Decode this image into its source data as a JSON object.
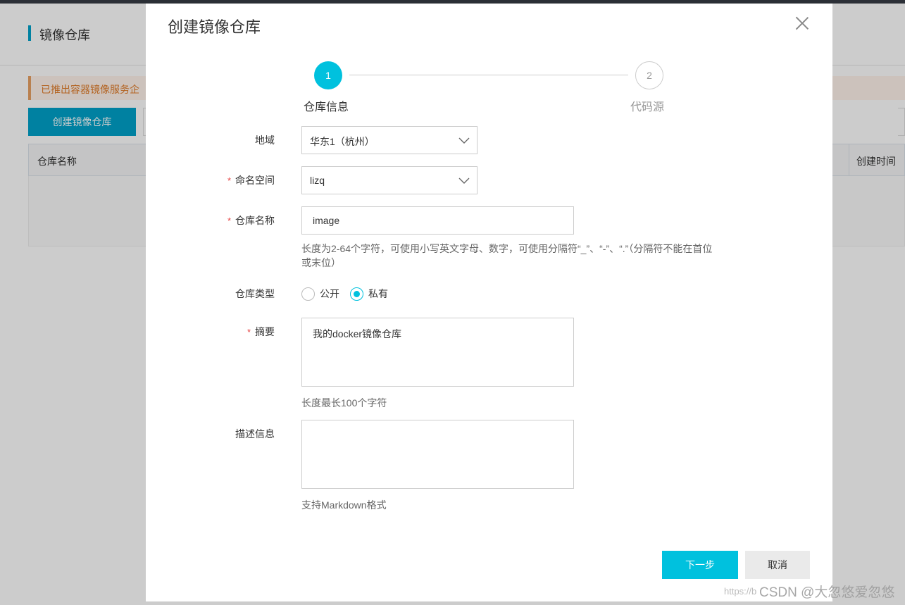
{
  "background": {
    "page_title": "镜像仓库",
    "notice": "已推出容器镜像服务企",
    "create_button": "创建镜像仓库",
    "table": {
      "col_name": "仓库名称",
      "col_created": "创建时间"
    }
  },
  "dialog": {
    "title": "创建镜像仓库",
    "steps": [
      {
        "number": "1",
        "label": "仓库信息"
      },
      {
        "number": "2",
        "label": "代码源"
      }
    ],
    "region": {
      "label": "地域",
      "value": "华东1（杭州）"
    },
    "namespace": {
      "label": "命名空间",
      "required_mark": "*",
      "value": "lizq"
    },
    "repo_name": {
      "label": "仓库名称",
      "required_mark": "*",
      "value": "image",
      "hint_line1": "长度为2-64个字符，可使用小写英文字母、数字，可使用分隔符“_”、“-”、“.”（分隔符不能在首位",
      "hint_line2": "或末位）"
    },
    "repo_type": {
      "label": "仓库类型",
      "options": [
        "公开",
        "私有"
      ],
      "selected": "私有"
    },
    "summary": {
      "label": "摘要",
      "required_mark": "*",
      "value": "我的docker镜像仓库",
      "hint": "长度最长100个字符"
    },
    "description": {
      "label": "描述信息",
      "value": "",
      "hint": "支持Markdown格式"
    },
    "buttons": {
      "next": "下一步",
      "cancel": "取消"
    }
  },
  "watermark": {
    "url": "https://b",
    "text": "CSDN @大忽悠爱忽悠"
  },
  "colors": {
    "accent": "#00c1de",
    "primary_bg": "#00a2ca",
    "required": "#e64545"
  }
}
